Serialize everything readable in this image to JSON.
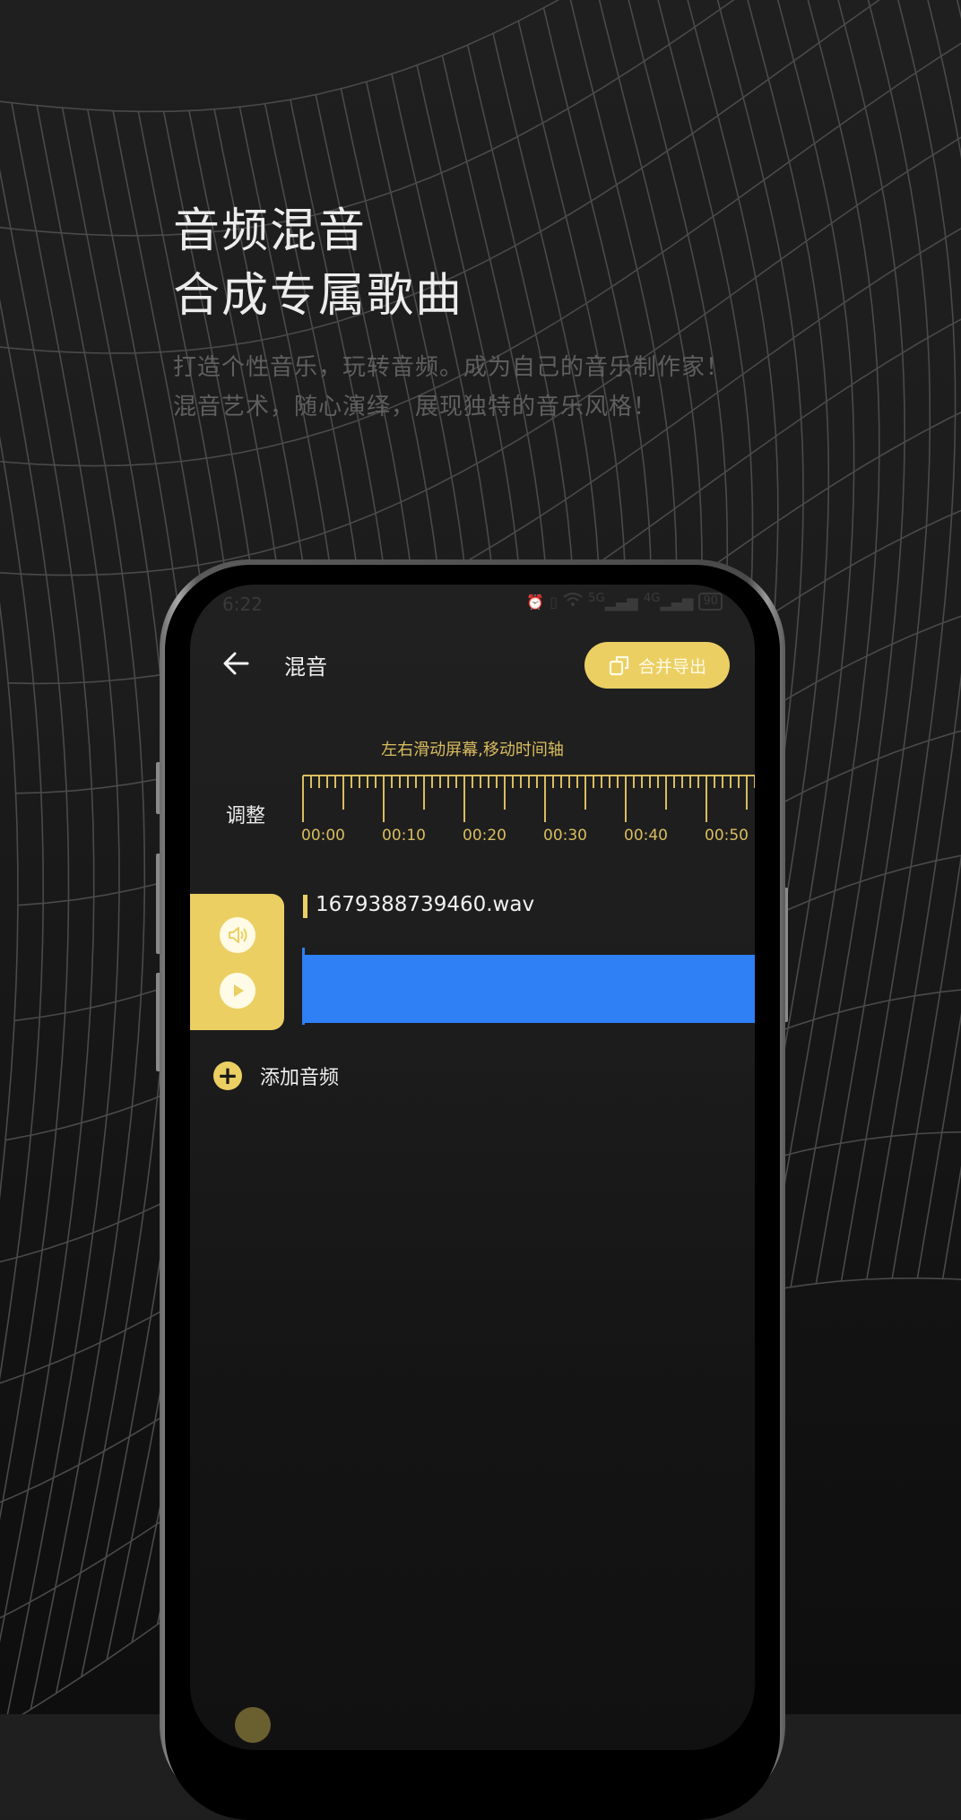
{
  "promo": {
    "headline_line1": "音频混音",
    "headline_line2": "合成专属歌曲",
    "subtitle_line1": "打造个性音乐，玩转音频。成为自己的音乐制作家！",
    "subtitle_line2": "混音艺术，随心演绎，展现独特的音乐风格！"
  },
  "status_bar": {
    "time": "6:22",
    "icons": [
      "alarm-icon",
      "vibrate-icon",
      "wifi-icon",
      "signal-5g-icon",
      "signal-4g-icon",
      "battery-icon"
    ],
    "signal1_label": "5G",
    "signal2_label": "4G",
    "battery": "90"
  },
  "header": {
    "title": "混音",
    "export_button": "合并导出"
  },
  "timeline": {
    "hint": "左右滑动屏幕,移动时间轴",
    "adjust_label": "调整",
    "labels": [
      "00:00",
      "00:10",
      "00:20",
      "00:30",
      "00:40",
      "00:50"
    ],
    "visible_seconds": 56,
    "major_every_s": 10,
    "medium_every_s": 5
  },
  "tracks": [
    {
      "file_name": "1679388739460.wav",
      "color": "#2f7ff5"
    }
  ],
  "add_audio": {
    "label": "添加音频"
  },
  "colors": {
    "accent": "#ebcf63",
    "waveform": "#2f7ff5",
    "ruler": "#d9bd5f"
  }
}
